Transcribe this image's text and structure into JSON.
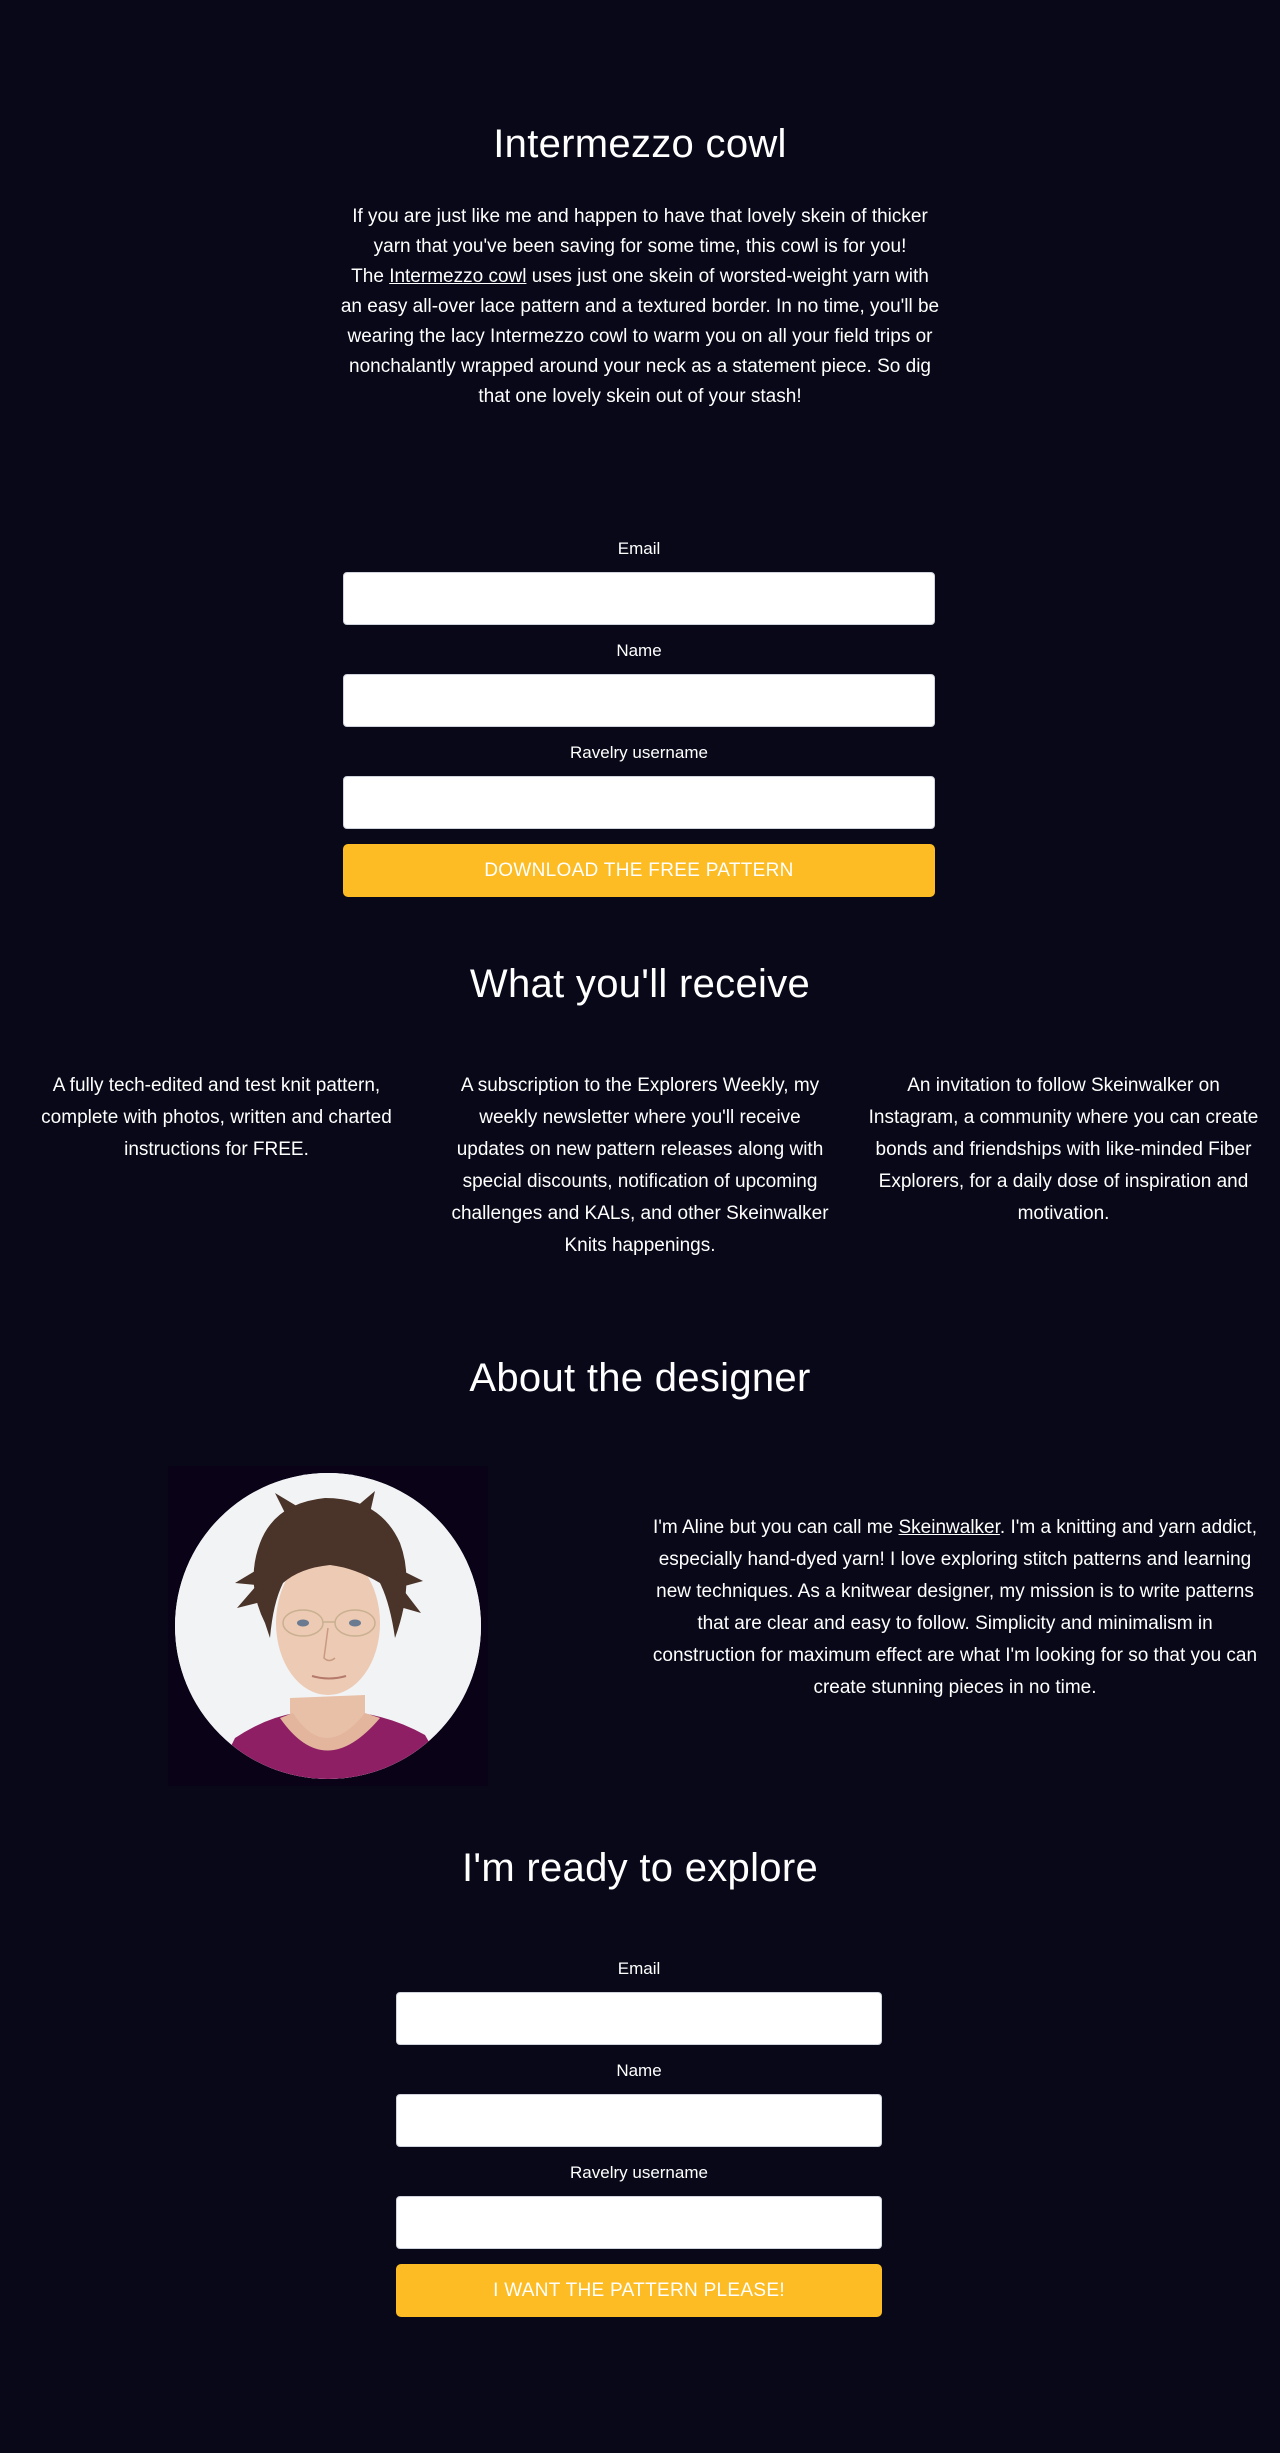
{
  "hero": {
    "title": "Intermezzo cowl",
    "intro_line": "If you are just like me and happen to have that lovely skein of thicker yarn that you've been saving for some time, this cowl is for you!",
    "body_prefix": "The ",
    "link_text": "Intermezzo cowl",
    "body_suffix": " uses just one skein of worsted-weight yarn with an easy all-over lace pattern and a textured border. In no time, you'll be wearing the lacy Intermezzo cowl to warm you on all your field trips or nonchalantly wrapped around your neck as a statement piece. So dig that one lovely skein out of your stash!"
  },
  "form_top": {
    "email_label": "Email",
    "email_value": "",
    "name_label": "Name",
    "name_value": "",
    "ravelry_label": "Ravelry username",
    "ravelry_value": "",
    "submit_label": "DOWNLOAD THE FREE PATTERN"
  },
  "receive": {
    "title": "What you'll receive",
    "items": [
      {
        "text": "A fully tech-edited and test knit pattern, complete with photos, written and charted instructions for FREE."
      },
      {
        "text": "A subscription to the Explorers Weekly, my weekly newsletter where you'll receive updates on new pattern releases along with special discounts, notification of upcoming challenges and KALs, and other Skeinwalker Knits happenings."
      },
      {
        "text": "An invitation to follow Skeinwalker on Instagram, a community where you can create bonds and friendships with like-minded Fiber Explorers, for a daily dose of inspiration and motivation."
      }
    ]
  },
  "about": {
    "title": "About the designer",
    "photo_alt": "Portrait of the designer",
    "text_prefix": "I'm Aline but you can call me ",
    "link_text": "Skeinwalker",
    "text_suffix": ". I'm a knitting and yarn addict, especially hand-dyed yarn! I love exploring stitch patterns and learning new techniques. As a knitwear designer, my mission is to write patterns that are clear and easy to follow. Simplicity and minimalism in construction for maximum effect are what I'm looking for so that you can create stunning pieces in no time."
  },
  "cta": {
    "title": "I'm ready to explore"
  },
  "form_bottom": {
    "email_label": "Email",
    "email_value": "",
    "name_label": "Name",
    "name_value": "",
    "ravelry_label": "Ravelry username",
    "ravelry_value": "",
    "submit_label": "I WANT THE PATTERN PLEASE!"
  },
  "colors": {
    "background": "#080818",
    "accent": "#fdbc24",
    "text": "#ffffff"
  }
}
